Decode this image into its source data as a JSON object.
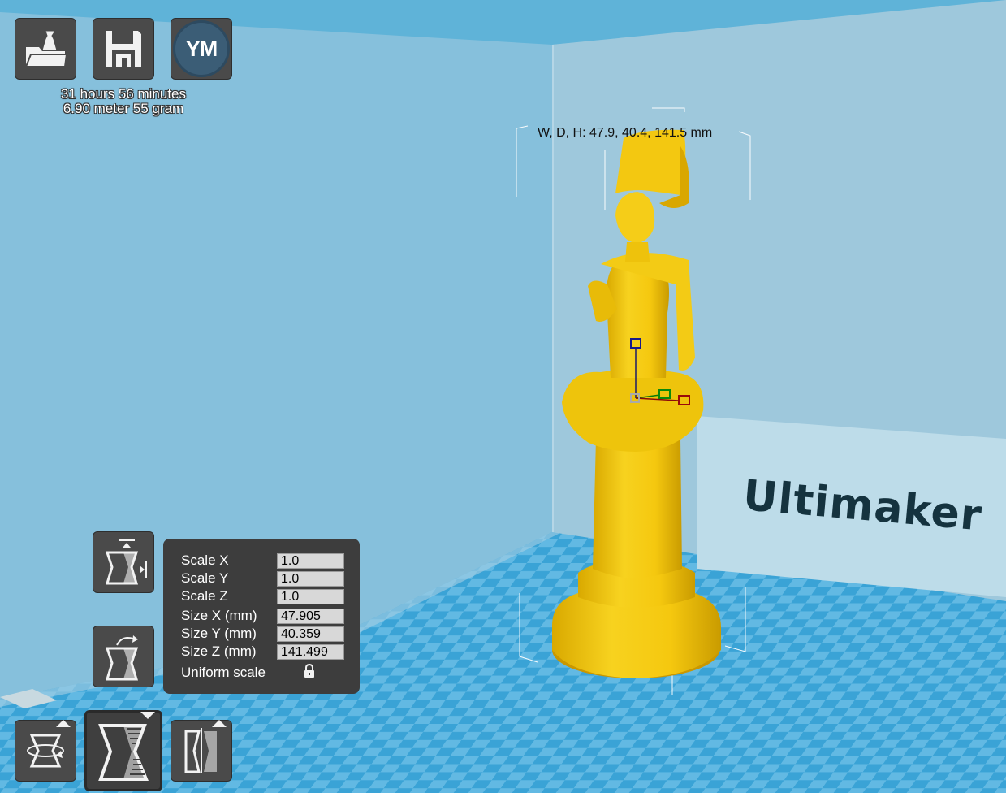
{
  "app": "Cura",
  "print_info": {
    "time": "31 hours 56 minutes",
    "material": "6.90 meter 55 gram"
  },
  "toolbar": {
    "load_icon": "load-model-icon",
    "save_icon": "save-disk-icon",
    "account_initials": "YM"
  },
  "model": {
    "dimensions_label": "W, D, H: 47.9, 40.4, 141.5 mm",
    "color": "#f5cb16"
  },
  "scale_panel": {
    "rows": [
      {
        "label": "Scale X",
        "value": "1.0"
      },
      {
        "label": "Scale Y",
        "value": "1.0"
      },
      {
        "label": "Scale Z",
        "value": "1.0"
      },
      {
        "label": "Size X (mm)",
        "value": "47.905"
      },
      {
        "label": "Size Y (mm)",
        "value": "40.359"
      },
      {
        "label": "Size Z (mm)",
        "value": "141.499"
      }
    ],
    "uniform_label": "Uniform scale",
    "uniform_icon": "lock-icon"
  },
  "tools": {
    "rotate_icon": "rotate-tool-icon",
    "scale_icon": "scale-tool-icon",
    "mirror_icon": "mirror-tool-icon",
    "scale_max_icon": "scale-to-max-icon",
    "reset_scale_icon": "reset-scale-icon"
  },
  "brand_text": "Ultimaker",
  "colors": {
    "sky": "#86c0dc",
    "floor_a": "#2f9bd0",
    "floor_b": "#5ab4e0",
    "panel": "#3d3d3d",
    "button": "#4a4a4a"
  }
}
